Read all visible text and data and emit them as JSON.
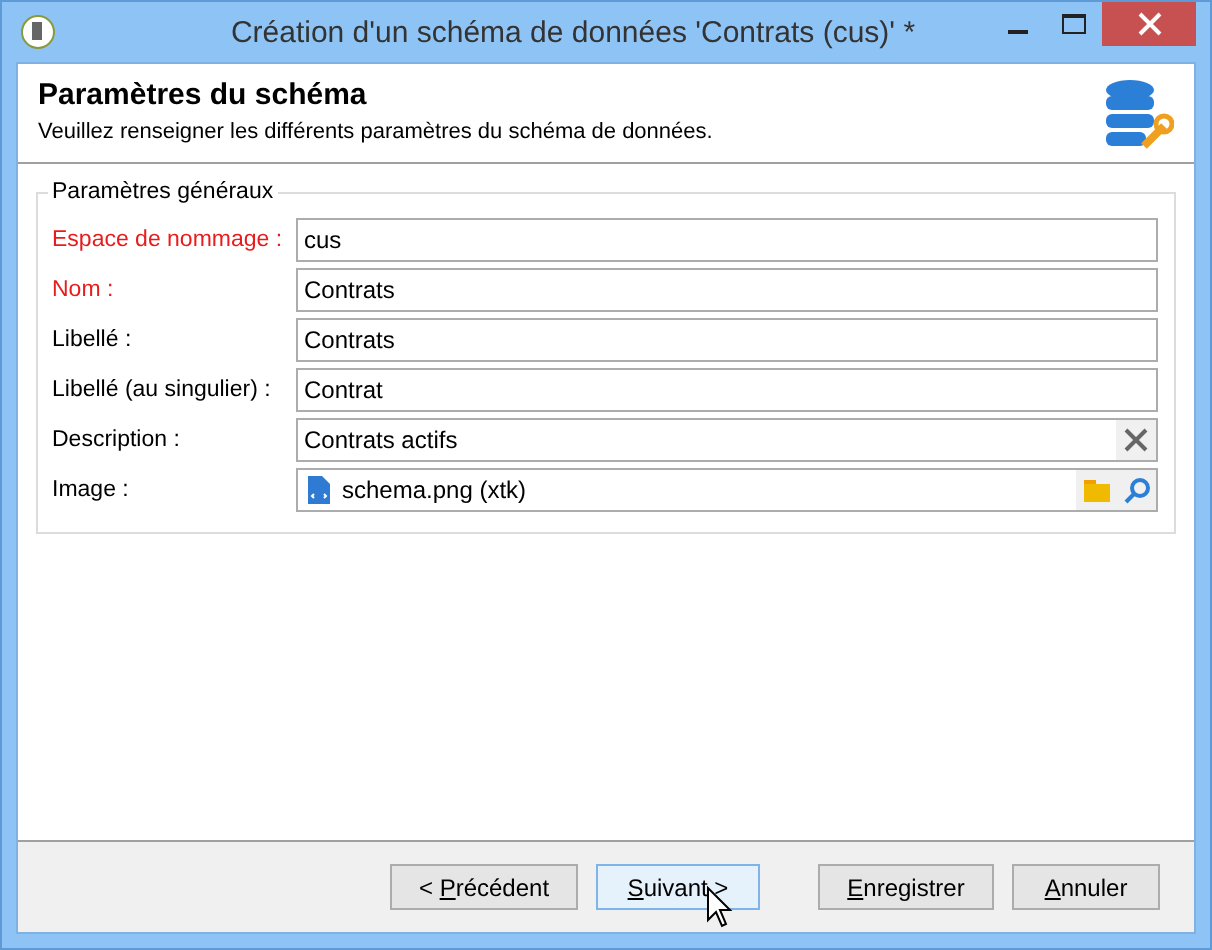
{
  "window": {
    "title": "Création d'un schéma de données 'Contrats (cus)' *"
  },
  "header": {
    "title": "Paramètres du schéma",
    "subtitle": "Veuillez renseigner les différents paramètres du schéma de données."
  },
  "group": {
    "title": "Paramètres généraux",
    "fields": [
      {
        "label": "Espace de nommage :",
        "required": true,
        "kind": "text",
        "value": "cus"
      },
      {
        "label": "Nom :",
        "required": true,
        "kind": "text",
        "value": "Contrats"
      },
      {
        "label": "Libellé :",
        "required": false,
        "kind": "text",
        "value": "Contrats"
      },
      {
        "label": "Libellé (au singulier) :",
        "required": false,
        "kind": "text",
        "value": "Contrat"
      },
      {
        "label": "Description :",
        "required": false,
        "kind": "clearable",
        "value": "Contrats actifs"
      },
      {
        "label": "Image :",
        "required": false,
        "kind": "image",
        "value": "schema.png (xtk)"
      }
    ]
  },
  "buttons": [
    {
      "before": "< ",
      "key": "P",
      "after": "récédent",
      "focused": false
    },
    {
      "key": "S",
      "after": "uivant >",
      "focused": true
    },
    {
      "key": "E",
      "after": "nregistrer",
      "focused": false
    },
    {
      "key": "A",
      "after": "nnuler",
      "focused": false
    }
  ]
}
